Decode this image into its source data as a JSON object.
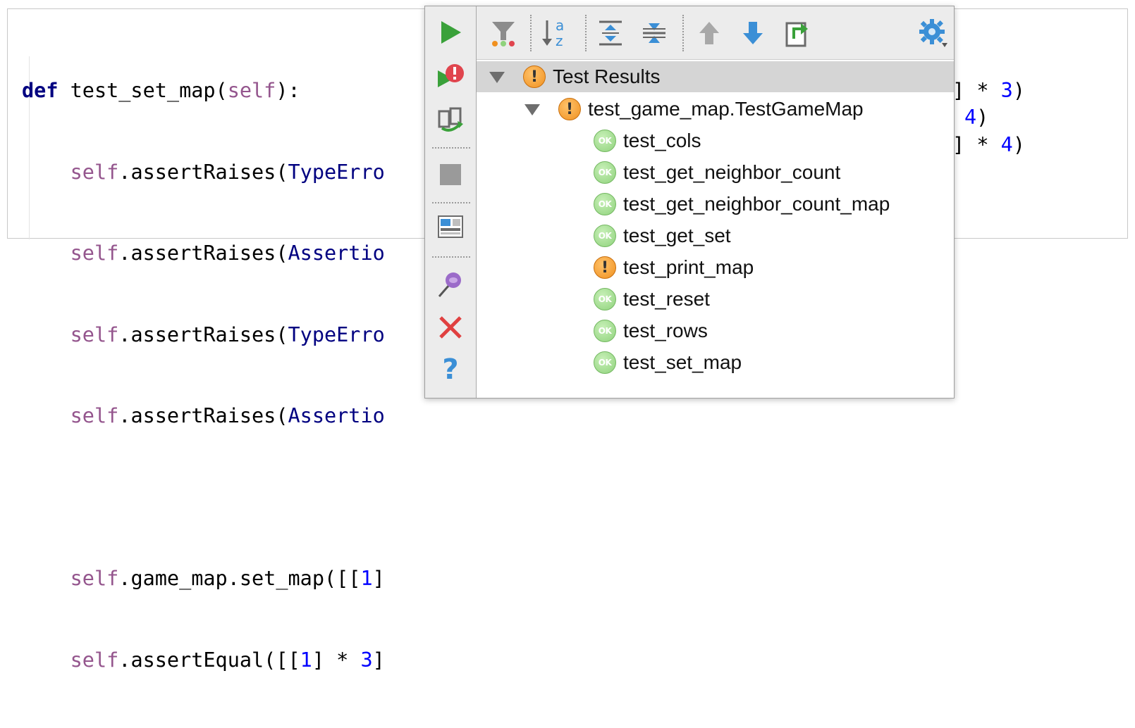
{
  "editor": {
    "line1": {
      "kw": "def",
      "name": " test_set_map(",
      "self": "self",
      "end": "):"
    },
    "line2": {
      "self": "self",
      "mid": ".assertRaises(",
      "cls": "TypeErro"
    },
    "line3": {
      "self": "self",
      "mid": ".assertRaises(",
      "cls": "Assertio"
    },
    "line4": {
      "self": "self",
      "mid": ".assertRaises(",
      "cls": "TypeErro"
    },
    "line5": {
      "self": "self",
      "mid": ".assertRaises(",
      "cls": "Assertio"
    },
    "line7": {
      "self": "self",
      "mid": ".game_map.set_map([[",
      "num": "1",
      "end": "]"
    },
    "line8": {
      "self": "self",
      "mid": ".assertEqual([[",
      "num": "1",
      "mid2": "] * ",
      "num2": "3",
      "end": "]"
    },
    "right1": {
      "pre": "] * ",
      "num": "3",
      "end": ")"
    },
    "right2": {
      "num": "4",
      "end": ")"
    },
    "right3": {
      "pre": "] * ",
      "num": "4",
      "end": ")"
    }
  },
  "toolbar": {
    "side": [
      "run-icon",
      "rerun-failed-icon",
      "toggle-auto-test-icon",
      "stop-icon",
      "layout-icon",
      "pin-icon",
      "close-icon",
      "help-icon"
    ],
    "top": [
      "filter-icon",
      "sort-alpha-icon",
      "expand-all-icon",
      "collapse-all-icon",
      "previous-icon",
      "next-icon",
      "export-icon",
      "settings-icon"
    ]
  },
  "tree": {
    "root": {
      "label": "Test Results",
      "status": "warning"
    },
    "suite": {
      "label": "test_game_map.TestGameMap",
      "status": "warning"
    },
    "tests": [
      {
        "label": "test_cols",
        "status": "ok"
      },
      {
        "label": "test_get_neighbor_count",
        "status": "ok"
      },
      {
        "label": "test_get_neighbor_count_map",
        "status": "ok"
      },
      {
        "label": "test_get_set",
        "status": "ok"
      },
      {
        "label": "test_print_map",
        "status": "warning"
      },
      {
        "label": "test_reset",
        "status": "ok"
      },
      {
        "label": "test_rows",
        "status": "ok"
      },
      {
        "label": "test_set_map",
        "status": "ok"
      }
    ],
    "ok_badge_text": "OK",
    "warn_badge_text": "!"
  },
  "colors": {
    "keyword": "#000080",
    "self": "#94558d",
    "number": "#0000ff",
    "ok": "#8fd27c",
    "warning": "#f0901f",
    "run": "#3aa13a",
    "stop": "#9a9a9a",
    "close": "#e04040",
    "help": "#3b8fd6"
  }
}
